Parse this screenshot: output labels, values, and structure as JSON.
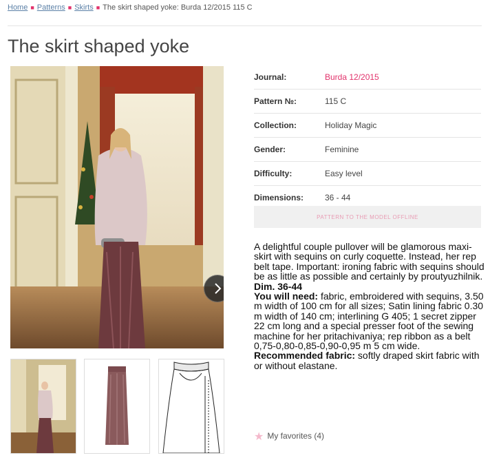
{
  "breadcrumb": {
    "home": "Home",
    "patterns": "Patterns",
    "skirts": "Skirts",
    "current": "The skirt shaped yoke: Burda 12/2015 115 C"
  },
  "page": {
    "title": "The skirt shaped yoke"
  },
  "properties": [
    {
      "label": "Journal:",
      "value": "Burda 12/2015"
    },
    {
      "label": "Pattern №:",
      "value": "115 C"
    },
    {
      "label": "Collection:",
      "value": "Holiday Magic"
    },
    {
      "label": "Gender:",
      "value": "Feminine"
    },
    {
      "label": "Difficulty:",
      "value": "Easy level"
    },
    {
      "label": "Dimensions:",
      "value": "36 - 44"
    }
  ],
  "offline_button": "PATTERN TO THE MODEL OFFLINE",
  "description": {
    "intro": "A delightful couple pullover will be glamorous maxi-skirt with sequins on curly coquette. Instead, her rep belt tape. Important: ironing fabric with sequins should be as little as possible and certainly by proutyuzhilnik.",
    "dim": "Dim. 36-44",
    "need_label": "You will need:",
    "need_text": " fabric, embroidered with sequins, 3.50 m width of 100 cm for all sizes; Satin lining fabric 0.30 m width of 140 cm; interlining G 405; 1 secret zipper 22 cm long and a special presser foot of the sewing machine for her pritachivaniya; rep ribbon as a belt 0,75-0,80-0,85-0,90-0,95 m 5 cm wide.",
    "rec_label": "Recommended fabric:",
    "rec_text": " softly draped skirt fabric with or without elastane."
  },
  "favorites": {
    "label": "My favorites (4)"
  },
  "colors": {
    "accent": "#e2326b",
    "link": "#5a7fa6"
  },
  "icons": {
    "next": "chevron-right-icon",
    "favorite": "star-icon"
  }
}
